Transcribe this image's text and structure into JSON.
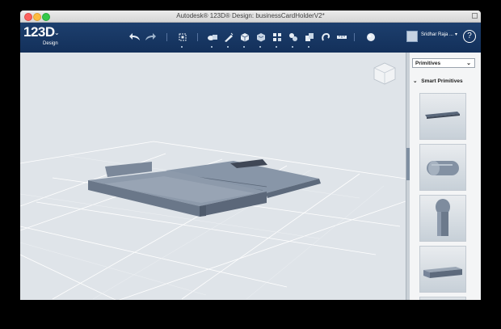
{
  "window": {
    "title": "Autodesk® 123D® Design: businessCardHolderV2*"
  },
  "toolbar": {
    "logo_main": "123D",
    "logo_sub": "Design",
    "icons": [
      "undo-icon",
      "redo-icon",
      "transform-icon",
      "primitives-icon",
      "sketch-icon",
      "construct-icon",
      "modify-icon",
      "pattern-icon",
      "grouping-icon",
      "combine-icon",
      "snap-icon",
      "measure-icon",
      "text-icon",
      "material-icon"
    ],
    "user_name": "Sridhar Raja ...",
    "help_label": "?"
  },
  "panel": {
    "dropdown_value": "Primitives",
    "section_title": "Smart Primitives",
    "thumbnails": [
      "text-primitive-thumb",
      "capsule-primitive-thumb",
      "peg-primitive-thumb",
      "bar-primitive-thumb"
    ]
  },
  "colors": {
    "toolbar_bg": "#173866",
    "viewport_bg": "#dfe4e9",
    "model_top": "#8e9bab",
    "model_side": "#5e6b7b",
    "grid_line": "#ffffff"
  }
}
